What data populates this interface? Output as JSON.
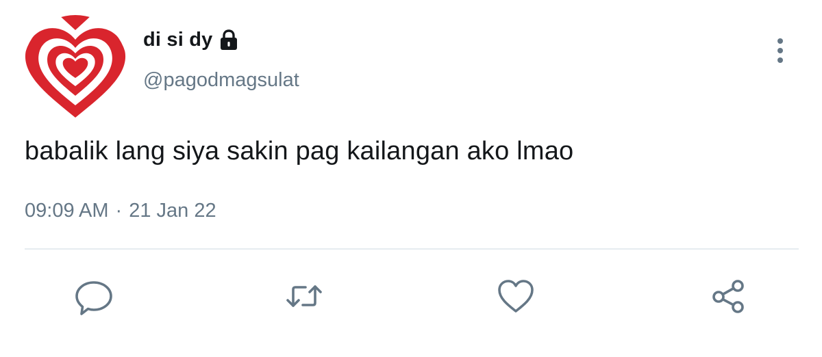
{
  "user": {
    "display_name": "di si dy",
    "handle": "@pagodmagsulat",
    "avatar_icon": "red-heart-logo",
    "badge_icon": "lock-icon"
  },
  "tweet": {
    "text": "babalik lang siya sakin pag kailangan ako lmao",
    "time": "09:09 AM",
    "separator": "·",
    "date": "21 Jan 22"
  },
  "actions": [
    {
      "name": "reply",
      "icon": "speech-bubble-icon"
    },
    {
      "name": "retweet",
      "icon": "retweet-icon"
    },
    {
      "name": "like",
      "icon": "heart-icon"
    },
    {
      "name": "share",
      "icon": "share-icon"
    }
  ],
  "colors": {
    "text_primary": "#14171a",
    "text_secondary": "#657786",
    "icon": "#657786",
    "avatar_red": "#d9252d",
    "divider": "#e6ecf0"
  }
}
